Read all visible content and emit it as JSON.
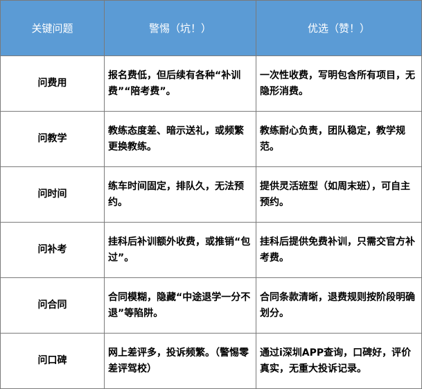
{
  "table": {
    "headers": [
      "关键问题",
      "警惕（坑！）",
      "优选（赞！）"
    ],
    "rows": [
      [
        "问费用",
        "报名费低，但后续有各种“补训费”“陪考费”。",
        "一次性收费，写明包含所有项目，无隐形消费。"
      ],
      [
        "问教学",
        "教练态度差、暗示送礼，或频繁更换教练。",
        "教练耐心负责，团队稳定，教学规范。"
      ],
      [
        "问时间",
        "练车时间固定，排队久，无法预约。",
        "提供灵活班型（如周末班），可自主预约。"
      ],
      [
        "问补考",
        "挂科后补训额外收费，或推销“包过”。",
        "挂科后提供免费补训，只需交官方补考费。"
      ],
      [
        "问合同",
        "合同模糊，隐藏“中途退学一分不退”等陷阱。",
        "合同条款清晰，退费规则按阶段明确划分。"
      ],
      [
        "问口碑",
        "网上差评多，投诉频繁。（警惕零差评驾校）",
        "通过i深圳APP查询，口碑好，评价真实，无重大投诉记录。"
      ]
    ]
  },
  "colors": {
    "header_bg": "#5b9bd5",
    "header_text": "#ffffff",
    "border": "#7a7a7a",
    "body_text": "#000000"
  }
}
